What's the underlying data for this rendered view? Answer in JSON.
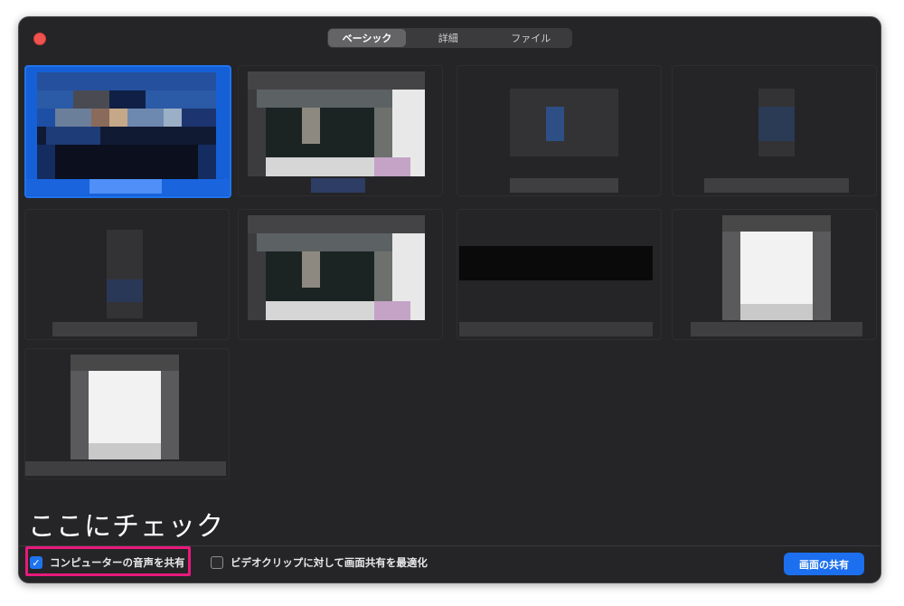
{
  "tabs": [
    {
      "label": "ベーシック",
      "active": true
    },
    {
      "label": "詳細",
      "active": false
    },
    {
      "label": "ファイル",
      "active": false
    }
  ],
  "annotation": "ここにチェック",
  "options": {
    "share_sound": {
      "label": "コンピューターの音声を共有",
      "checked": true
    },
    "optimize_video": {
      "label": "ビデオクリップに対して画面共有を最適化",
      "checked": false
    }
  },
  "share_button": "画面の共有",
  "check_mark": "✓",
  "thumbnails": [
    {
      "id": "desktop",
      "selected": true
    },
    {
      "id": "window-2",
      "selected": false
    },
    {
      "id": "window-3",
      "selected": false
    },
    {
      "id": "window-4",
      "selected": false
    },
    {
      "id": "window-5",
      "selected": false
    },
    {
      "id": "window-6",
      "selected": false
    },
    {
      "id": "window-7",
      "selected": false
    },
    {
      "id": "window-8",
      "selected": false
    },
    {
      "id": "window-9",
      "selected": false
    }
  ],
  "colors": {
    "accent": "#1e74ee",
    "highlight": "#e8197c",
    "window_bg": "#252527"
  }
}
